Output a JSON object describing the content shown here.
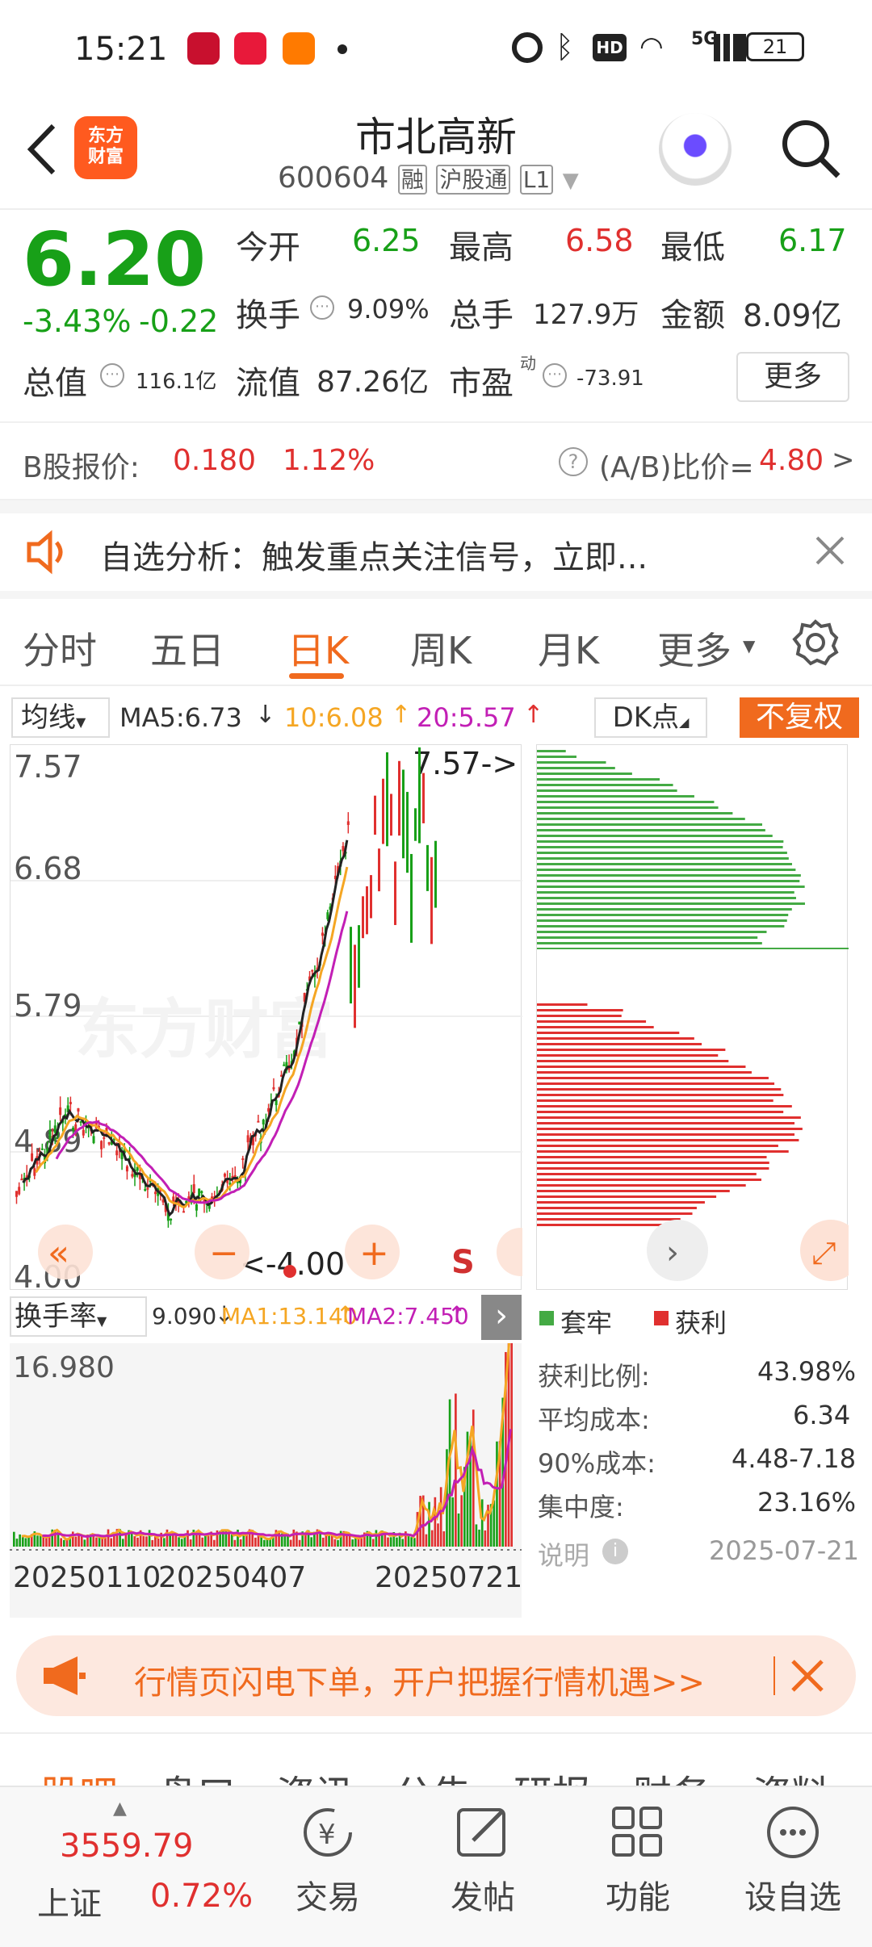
{
  "status_bar": {
    "time": "15:21",
    "battery": "21",
    "net": "5G"
  },
  "header": {
    "title": "市北高新",
    "code": "600604",
    "badge1": "融",
    "badge2": "沪股通",
    "badge3": "L1",
    "logo_line1": "东方",
    "logo_line2": "财富"
  },
  "quote": {
    "price": "6.20",
    "change_pct": "-3.43%",
    "change": "-0.22",
    "open_label": "今开",
    "open": "6.25",
    "high_label": "最高",
    "high": "6.58",
    "low_label": "最低",
    "low": "6.17",
    "turnover_label": "换手",
    "turnover": "9.09%",
    "volume_label": "总手",
    "volume": "127.9万",
    "amount_label": "金额",
    "amount": "8.09亿",
    "mktcap_label": "总值",
    "mktcap": "116.1亿",
    "float_label": "流值",
    "float": "87.26亿",
    "pe_label": "市盈",
    "pe_sup": "动",
    "pe": "-73.91",
    "more_button": "更多"
  },
  "b_share": {
    "label": "B股报价:",
    "price": "0.180",
    "pct": "1.12%",
    "ratio_label": "(A/B)比价=",
    "ratio": "4.80",
    "arrow": ">"
  },
  "notice": {
    "text": "自选分析：触发重点关注信号，立即..."
  },
  "tabs": [
    {
      "label": "分时"
    },
    {
      "label": "五日"
    },
    {
      "label": "日K"
    },
    {
      "label": "周K"
    },
    {
      "label": "月K"
    },
    {
      "label": "更多"
    }
  ],
  "ma_bar": {
    "selector": "均线",
    "ma5": "MA5:6.73",
    "ma10": "10:6.08",
    "ma20": "20:5.57",
    "dk": "DK点",
    "adjust": "不复权"
  },
  "kline": {
    "y_labels": [
      "7.57",
      "6.68",
      "5.79",
      "4.89",
      "4.00"
    ],
    "max_label": "7.57->",
    "min_label": "<-4.00",
    "s_marker": "S",
    "watermark": "东方财富"
  },
  "volume_panel": {
    "selector": "换手率",
    "val": "9.090",
    "ma1": "MA1:13.140",
    "ma2": "MA2:7.450",
    "top": "16.980",
    "dates": [
      "20250110",
      "20250407",
      "20250721"
    ]
  },
  "chip": {
    "legend_locked": "套牢",
    "legend_profit": "获利",
    "rows": [
      {
        "label": "获利比例:",
        "value": "43.98%"
      },
      {
        "label": "平均成本:",
        "value": "6.34"
      },
      {
        "label": "90%成本:",
        "value": "4.48-7.18"
      },
      {
        "label": "集中度:",
        "value": "23.16%"
      }
    ],
    "note_label": "说明",
    "date": "2025-07-21"
  },
  "promo": {
    "text": "行情页闪电下单，开户把握行情机遇>>"
  },
  "sub_tabs": [
    "股吧",
    "盘口",
    "资讯",
    "公告",
    "研报",
    "财务",
    "资料"
  ],
  "bottom": {
    "index_value": "3559.79",
    "index_name": "上证",
    "index_pct": "0.72%",
    "items": [
      "交易",
      "发帖",
      "功能",
      "设自选"
    ]
  },
  "colors": {
    "up": "#e0302f",
    "down": "#18a018",
    "accent": "#f06a1e",
    "ma10": "#f5a623",
    "ma20": "#c21fb5"
  }
}
